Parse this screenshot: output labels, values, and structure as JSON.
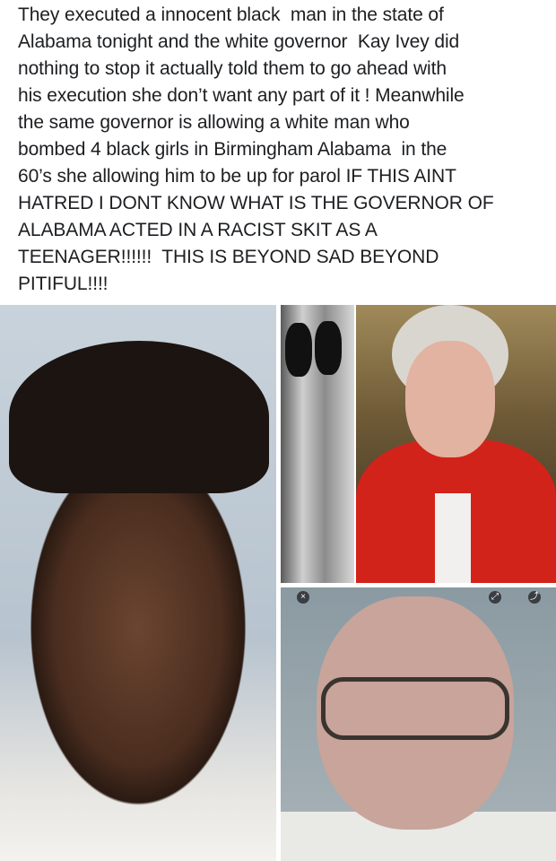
{
  "post": {
    "text_lines": [
      "They executed a innocent black  man in the state of",
      "Alabama tonight and the white governor  Kay Ivey did",
      "nothing to stop it actually told them to go ahead with",
      "his execution she don’t want any part of it ! Meanwhile",
      "the same governor is allowing a white man who",
      "bombed 4 black girls in Birmingham Alabama  in the",
      "60’s she allowing him to be up for parol IF THIS AINT",
      "HATRED I DONT KNOW WHAT IS THE GOVERNOR OF",
      "ALABAMA ACTED IN A RACIST SKIT AS A",
      "TEENAGER!!!!!!  THIS IS BEYOND SAD BEYOND",
      "PITIFUL!!!!"
    ]
  }
}
